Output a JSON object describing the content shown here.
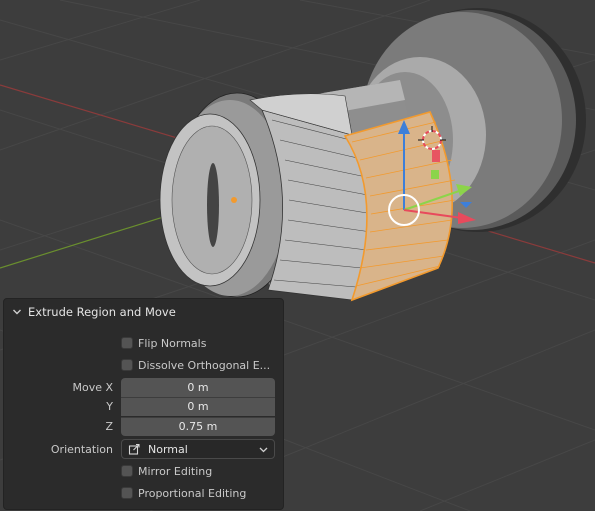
{
  "operator_panel": {
    "title": "Extrude Region and Move",
    "flip_normals_label": "Flip Normals",
    "flip_normals_checked": false,
    "dissolve_label": "Dissolve Orthogonal E...",
    "dissolve_checked": false,
    "move_x_label": "Move X",
    "move_x_value": "0 m",
    "move_y_label": "Y",
    "move_y_value": "0 m",
    "move_z_label": "Z",
    "move_z_value": "0.75 m",
    "orientation_label": "Orientation",
    "orientation_value": "Normal",
    "mirror_label": "Mirror Editing",
    "mirror_checked": false,
    "proportional_label": "Proportional Editing",
    "proportional_checked": false
  },
  "icons": [
    "chevron-down-icon",
    "orientation-normal-icon",
    "dropdown-chevron-icon",
    "3d-cursor-icon",
    "gizmo-arrow-z-icon",
    "gizmo-arrow-y-icon",
    "gizmo-arrow-x-icon"
  ],
  "colors": {
    "viewport_bg": "#3d3d3d",
    "grid_line": "#474747",
    "x_axis": "#8a3b3b",
    "y_axis": "#6a8f2e",
    "selection_orange": "#f29a2e",
    "gizmo_blue": "#3d7fd9",
    "gizmo_green": "#8cd44a",
    "gizmo_red": "#e84a5c",
    "panel_bg": "#2b2b2b",
    "field_bg": "#545454"
  }
}
